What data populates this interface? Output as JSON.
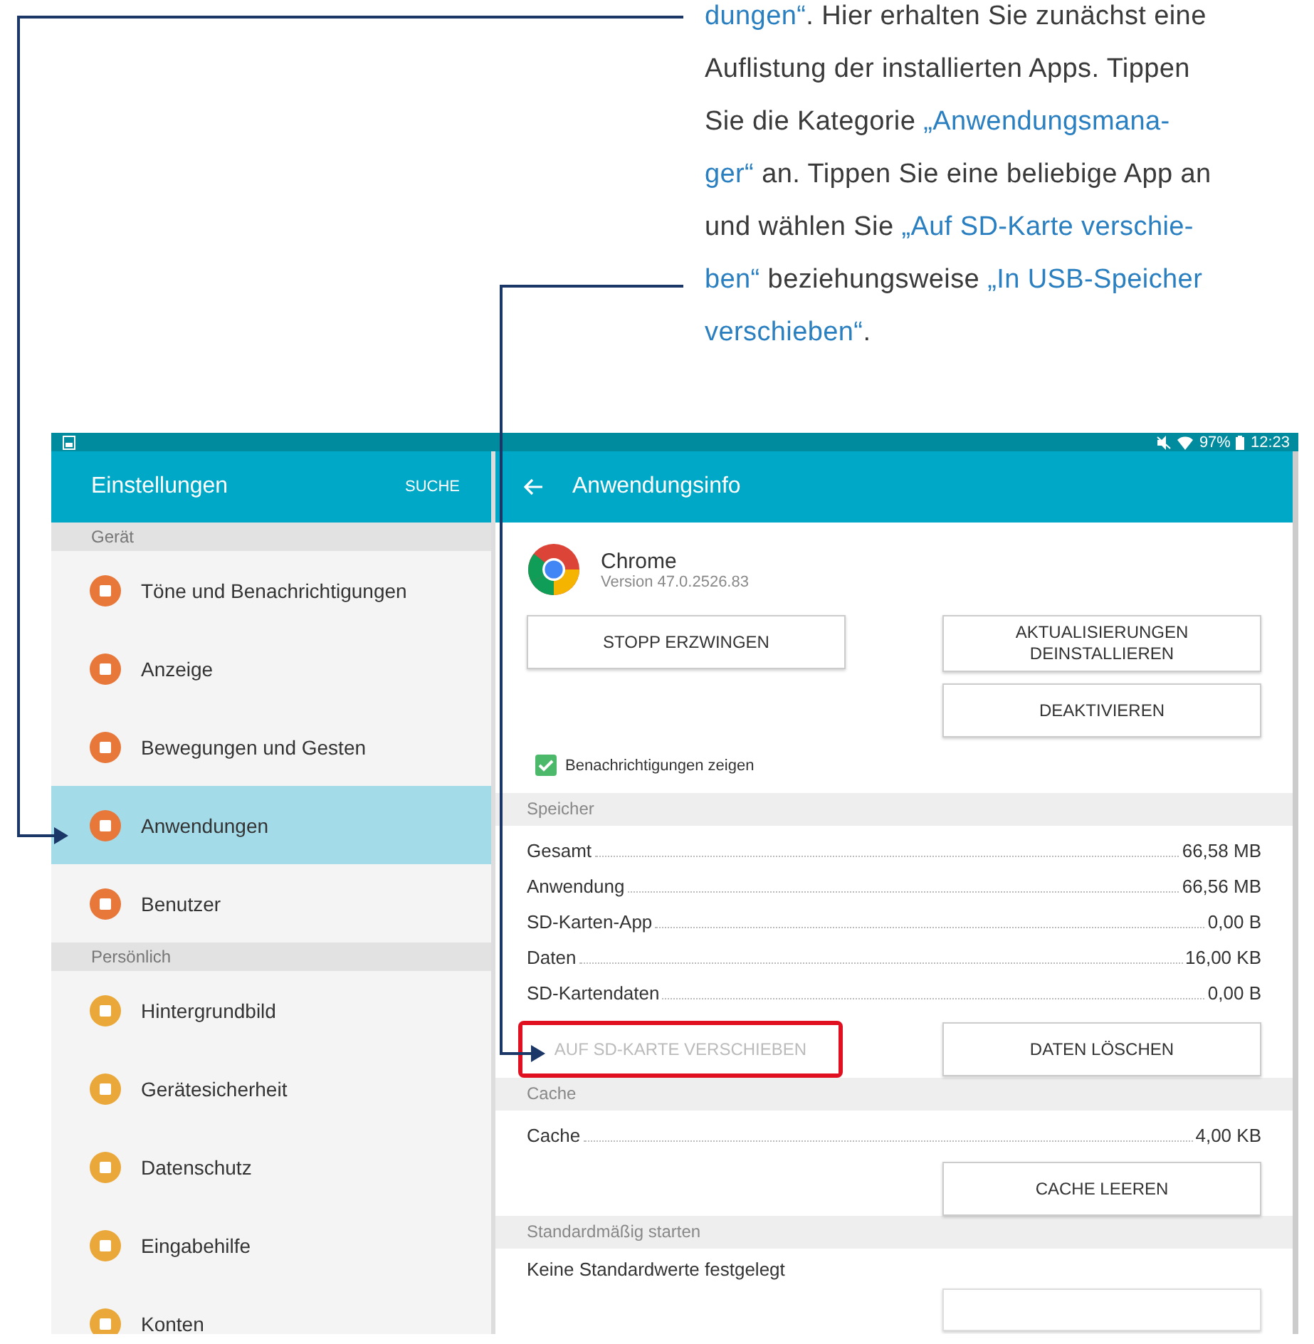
{
  "article": {
    "lines": [
      [
        {
          "text": "dungen“",
          "kind": "term"
        },
        {
          "text": ". Hier erhalten Sie zunächst eine",
          "kind": "plain"
        }
      ],
      [
        {
          "text": "Auflistung der installierten Apps. Tippen",
          "kind": "plain"
        }
      ],
      [
        {
          "text": "Sie die Kategorie ",
          "kind": "plain"
        },
        {
          "text": "„Anwendungsmana-",
          "kind": "term"
        }
      ],
      [
        {
          "text": "ger“",
          "kind": "term"
        },
        {
          "text": " an. Tippen Sie eine beliebige App an",
          "kind": "plain"
        }
      ],
      [
        {
          "text": "und wählen Sie ",
          "kind": "plain"
        },
        {
          "text": "„Auf SD-Karte verschie-",
          "kind": "term"
        }
      ],
      [
        {
          "text": "ben“",
          "kind": "term"
        },
        {
          "text": " beziehungsweise ",
          "kind": "plain"
        },
        {
          "text": "„In USB-Speicher",
          "kind": "term"
        }
      ],
      [
        {
          "text": "verschieben“",
          "kind": "term"
        },
        {
          "text": ".",
          "kind": "plain"
        }
      ]
    ]
  },
  "status_bar": {
    "battery": "97%",
    "time": "12:23"
  },
  "settings": {
    "title": "Einstellungen",
    "search": "SUCHE",
    "sections": [
      {
        "header": "Gerät",
        "items": [
          {
            "label": "Töne und Benachrichtigungen",
            "selected": false,
            "color": "#e8773a"
          },
          {
            "label": "Anzeige",
            "selected": false,
            "color": "#e8773a"
          },
          {
            "label": "Bewegungen und Gesten",
            "selected": false,
            "color": "#e8773a"
          },
          {
            "label": "Anwendungen",
            "selected": true,
            "color": "#e8773a"
          },
          {
            "label": "Benutzer",
            "selected": false,
            "color": "#e8773a"
          }
        ]
      },
      {
        "header": "Persönlich",
        "items": [
          {
            "label": "Hintergrundbild",
            "selected": false,
            "color": "#eaa83a"
          },
          {
            "label": "Gerätesicherheit",
            "selected": false,
            "color": "#eaa83a"
          },
          {
            "label": "Datenschutz",
            "selected": false,
            "color": "#eaa83a"
          },
          {
            "label": "Eingabehilfe",
            "selected": false,
            "color": "#eaa83a"
          },
          {
            "label": "Konten",
            "selected": false,
            "color": "#eaa83a"
          }
        ]
      }
    ]
  },
  "app_info": {
    "title": "Anwendungsinfo",
    "app_name": "Chrome",
    "version": "Version 47.0.2526.83",
    "force_stop": {
      "label": "STOPP ERZWINGEN",
      "disabled": false
    },
    "uninstall_updates": {
      "label": "AKTUALISIERUNGEN DEINSTALLIEREN",
      "disabled": false
    },
    "deactivate": {
      "label": "DEAKTIVIEREN",
      "disabled": false
    },
    "notifications": {
      "label": "Benachrichtigungen zeigen",
      "checked": true
    },
    "storage": {
      "header": "Speicher",
      "rows": [
        {
          "label": "Gesamt",
          "value": "66,58 MB"
        },
        {
          "label": "Anwendung",
          "value": "66,56 MB"
        },
        {
          "label": "SD-Karten-App",
          "value": "0,00 B"
        },
        {
          "label": "Daten",
          "value": "16,00 KB"
        },
        {
          "label": "SD-Kartendaten",
          "value": "0,00 B"
        }
      ],
      "move": {
        "label": "AUF SD-KARTE VERSCHIEBEN",
        "disabled": true,
        "highlighted": true
      },
      "clear": {
        "label": "DATEN LÖSCHEN",
        "disabled": false
      }
    },
    "cache": {
      "header": "Cache",
      "rows": [
        {
          "label": "Cache",
          "value": "4,00 KB"
        }
      ],
      "clear": {
        "label": "CACHE LEEREN",
        "disabled": false
      }
    },
    "defaults": {
      "header": "Standardmäßig starten",
      "text": "Keine Standardwerte festgelegt"
    }
  }
}
